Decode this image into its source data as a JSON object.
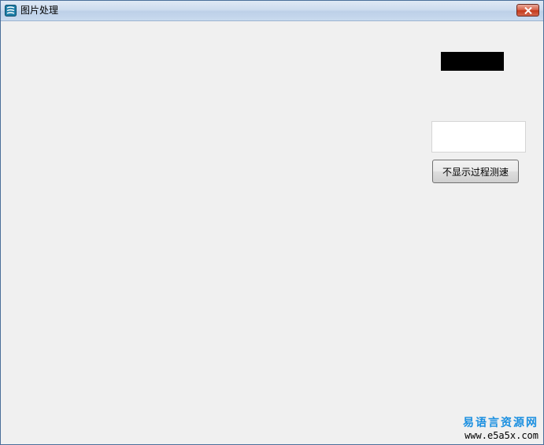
{
  "window": {
    "title": "图片处理",
    "close_icon": "close-x-icon",
    "app_icon": "app-logo-icon"
  },
  "main": {
    "text_field_value": "",
    "button_label": "不显示过程测速"
  },
  "watermark": {
    "chinese": "易语言资源网",
    "url": "www.e5a5x.com"
  },
  "colors": {
    "title_bar": "#cddcee",
    "close_button": "#c43a1c",
    "background": "#f0f0f0",
    "black_box": "#000000",
    "watermark_blue": "#1a8fe0"
  }
}
